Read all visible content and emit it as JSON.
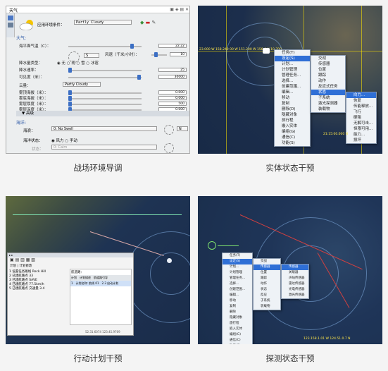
{
  "captions": {
    "tl": "战场环境导调",
    "tr": "实体状态干预",
    "bl": "行动计划干预",
    "br": "探测状态干预"
  },
  "weather": {
    "title": "天气",
    "apply_label": "应用环境条件：",
    "condition": "Partly Cloudy",
    "section_air": "大气:",
    "rows": [
      {
        "label": "海平面气温（C）：",
        "value": "22.22"
      },
      {
        "label": "风向：",
        "value": "S"
      },
      {
        "label": "风速（千米/小时）：",
        "value": "10"
      },
      {
        "label": "降水量类型：",
        "value": "◉ 无  ○ 雨  ○ 雪  ○ 冰雹"
      },
      {
        "label": "降水速率：",
        "value": "25"
      },
      {
        "label": "可见度（米）：",
        "value": "30000"
      },
      {
        "label": "云量：",
        "value": "Partly Cloudy"
      },
      {
        "label": "雾顶海拔（米）：",
        "value": "0.000"
      },
      {
        "label": "雾底海拔（米）：",
        "value": "0.000"
      },
      {
        "label": "雾层厚度（米）：",
        "value": "500"
      },
      {
        "label": "雾层深度（米）：",
        "value": "0.000"
      }
    ],
    "advanced": "高级",
    "section_sea": "海洋:",
    "sea_label": "海浪：",
    "sea_value": "0: No Swell",
    "sea_dir": "N",
    "sea_state_label": "海洋状态：",
    "sea_state_options": "◉ 风力  ○ 手动",
    "state_label": "状态：",
    "state_value": "0: Calm"
  },
  "entity_menu": {
    "coords": "23.000 W 158.240 00 W 151.200 W 156.0 N 10.700",
    "main": [
      "任务(T)",
      "设定(S)",
      "计划...",
      "计划管理",
      "管理任务...",
      "选择...",
      "创建范围...",
      "编辑...",
      "移动",
      "复制",
      "删除(D)",
      "隐藏对象",
      "旅行程",
      "嵌入实体",
      "编组(G)",
      "通信(C)",
      "功能(S)"
    ],
    "sub1": [
      "交战",
      "传感器",
      "位置",
      "跟踪",
      "动作",
      "反应式任务",
      "状态",
      "子系统",
      "激光探测器",
      "装载物"
    ],
    "sub2": [
      "向力...",
      "恢复",
      "传能释放...",
      "飞行",
      "硬阻",
      "无解可击...",
      "恒限可用...",
      "能力...",
      "损坏"
    ],
    "time": "21:15:00.000 N"
  },
  "plan": {
    "tabs": [
      "计划",
      "计划修改"
    ],
    "list": [
      "1  设置任务路线 Rock Hill",
      "2  已建航路点 33",
      "3  已建航路点 SAVE",
      "4  已建航路点 77.5km/h",
      "5  已建航路点 交通量 3.4"
    ],
    "sub_label": "航道路：",
    "status": "52.31.6074  123.45.9769",
    "cols": [
      "计划",
      "计划描述",
      "航道路引导"
    ],
    "row": [
      "1",
      "计划名称: 航线 01",
      "2.3 启动计划"
    ]
  },
  "detect_menu": {
    "main": [
      "任务(T)",
      "设定(S)",
      "计划...",
      "计划管理",
      "管理任务...",
      "选择...",
      "创建范围...",
      "编辑...",
      "移动",
      "复制",
      "删除",
      "隐藏对象",
      "旅行程",
      "嵌入实体",
      "编组(G)",
      "通信(C)",
      "功能(S)"
    ],
    "sub1": [
      "交战",
      "传感器",
      "位置",
      "跟踪",
      "动作",
      "状态",
      "反应",
      "子系统",
      "装载物"
    ],
    "sub2": [
      "传感器",
      "关联器",
      "声呐传感器",
      "雷达传感器",
      "光电传感器",
      "激光传感器"
    ],
    "coords": "123.158.1.01 W 124.51.0.7 N"
  }
}
